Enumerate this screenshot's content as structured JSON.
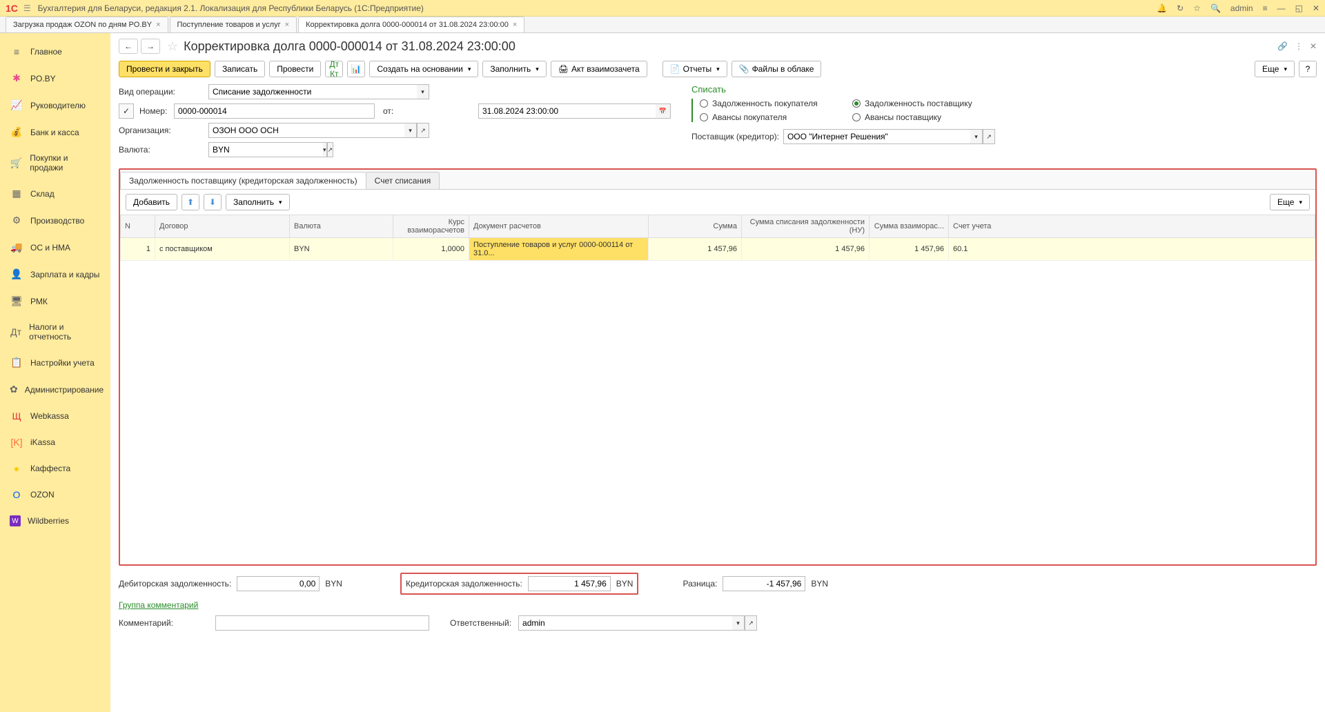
{
  "titlebar": {
    "logo": "1С",
    "app_title": "Бухгалтерия для Беларуси, редакция 2.1. Локализация для Республики Беларусь  (1С:Предприятие)",
    "user": "admin"
  },
  "tabs": [
    {
      "label": "Загрузка продаж OZON по дням PO.BY",
      "active": false
    },
    {
      "label": "Поступление товаров и услуг",
      "active": false
    },
    {
      "label": "Корректировка долга 0000-000014 от 31.08.2024 23:00:00",
      "active": true
    }
  ],
  "sidebar": {
    "items": [
      {
        "label": "Главное",
        "icon": "≡"
      },
      {
        "label": "PO.BY",
        "icon": "✱",
        "cls": "pobi"
      },
      {
        "label": "Руководителю",
        "icon": "📈"
      },
      {
        "label": "Банк и касса",
        "icon": "💰"
      },
      {
        "label": "Покупки и продажи",
        "icon": "🛒"
      },
      {
        "label": "Склад",
        "icon": "▦"
      },
      {
        "label": "Производство",
        "icon": "⚙"
      },
      {
        "label": "ОС и НМА",
        "icon": "🚚"
      },
      {
        "label": "Зарплата и кадры",
        "icon": "👤"
      },
      {
        "label": "РМК",
        "icon": "🖥"
      },
      {
        "label": "Налоги и отчетность",
        "icon": "Дт"
      },
      {
        "label": "Настройки учета",
        "icon": "📋"
      },
      {
        "label": "Администрирование",
        "icon": "✿"
      },
      {
        "label": "Webkassa",
        "icon": "Щ",
        "cls": "webkassa"
      },
      {
        "label": "iKassa",
        "icon": "[K]",
        "cls": "ikassa"
      },
      {
        "label": "Каффеста",
        "icon": "●",
        "cls": "kaffesta"
      },
      {
        "label": "OZON",
        "icon": "O",
        "cls": "ozon"
      },
      {
        "label": "Wildberries",
        "icon": "W",
        "cls": "wb"
      }
    ]
  },
  "page": {
    "title": "Корректировка долга 0000-000014 от 31.08.2024 23:00:00"
  },
  "toolbar": {
    "post_and_close": "Провести и закрыть",
    "write": "Записать",
    "post": "Провести",
    "create_based": "Создать на основании",
    "fill": "Заполнить",
    "offset_act": "Акт взаимозачета",
    "reports": "Отчеты",
    "files": "Файлы в облаке",
    "more": "Еще"
  },
  "form": {
    "operation_label": "Вид операции:",
    "operation_value": "Списание задолженности",
    "number_label": "Номер:",
    "number_value": "0000-000014",
    "date_label": "от:",
    "date_value": "31.08.2024 23:00:00",
    "org_label": "Организация:",
    "org_value": "ОЗОН ООО ОСН",
    "currency_label": "Валюта:",
    "currency_value": "BYN",
    "spisat_title": "Списать",
    "radio1": "Задолженность покупателя",
    "radio2": "Задолженность поставщику",
    "radio3": "Авансы покупателя",
    "radio4": "Авансы поставщику",
    "supplier_label": "Поставщик (кредитор):",
    "supplier_value": "ООО \"Интернет Решения\""
  },
  "inner_tabs": {
    "tab1": "Задолженность поставщику (кредиторская задолженность)",
    "tab2": "Счет списания"
  },
  "table_toolbar": {
    "add": "Добавить",
    "fill": "Заполнить",
    "more": "Еще"
  },
  "table": {
    "headers": {
      "n": "N",
      "contract": "Договор",
      "currency": "Валюта",
      "rate": "Курс взаиморасчетов",
      "doc": "Документ расчетов",
      "sum": "Сумма",
      "sum_nu": "Сумма списания задолженности (НУ)",
      "sum_mutual": "Сумма взаиморас...",
      "account": "Счет учета"
    },
    "rows": [
      {
        "n": "1",
        "contract": "с поставщиком",
        "currency": "BYN",
        "rate": "1,0000",
        "doc": "Поступление товаров и услуг 0000-000114 от 31.0...",
        "sum": "1 457,96",
        "sum_nu": "1 457,96",
        "sum_mutual": "1 457,96",
        "account": "60.1"
      }
    ]
  },
  "totals": {
    "debit_label": "Дебиторская задолженность:",
    "debit_value": "0,00",
    "debit_curr": "BYN",
    "credit_label": "Кредиторская задолженность:",
    "credit_value": "1 457,96",
    "credit_curr": "BYN",
    "diff_label": "Разница:",
    "diff_value": "-1 457,96",
    "diff_curr": "BYN"
  },
  "comments": {
    "link": "Группа комментарий",
    "label": "Комментарий:",
    "resp_label": "Ответственный:",
    "resp_value": "admin"
  }
}
